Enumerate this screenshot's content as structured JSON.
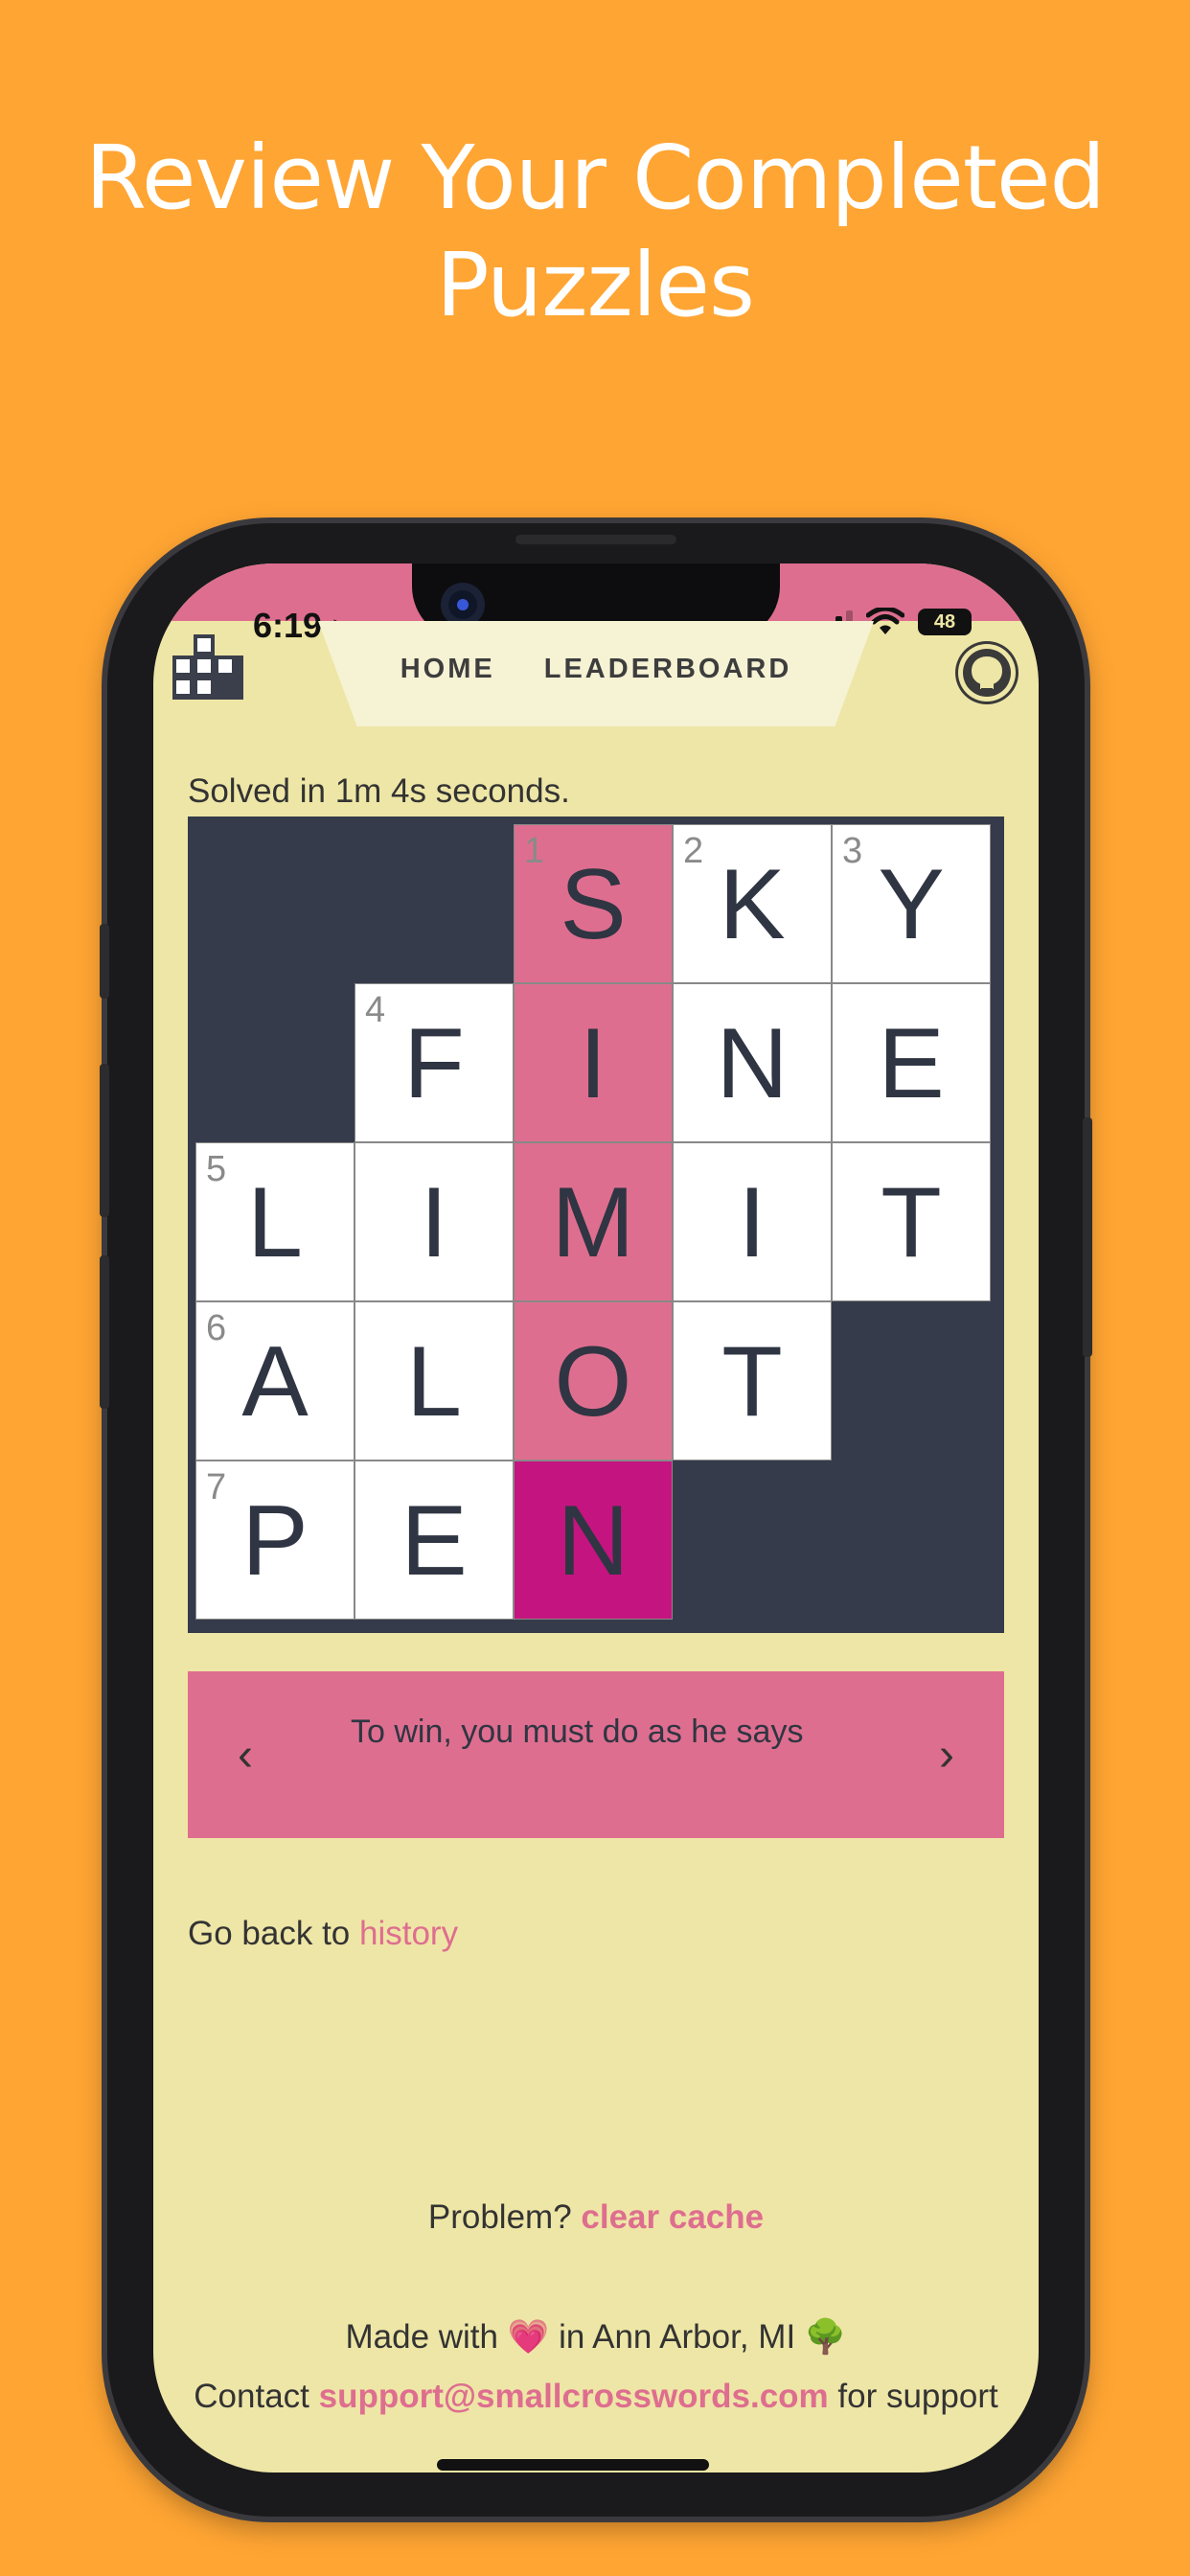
{
  "headline": {
    "line1": "Review Your Completed",
    "line2": "Puzzles"
  },
  "status_bar": {
    "time": "6:19",
    "battery": "48"
  },
  "nav": {
    "home": "HOME",
    "leaderboard": "LEADERBOARD"
  },
  "solved_text": "Solved in 1m 4s seconds.",
  "grid": {
    "cells": [
      {
        "row": 0,
        "col": 0,
        "state": "black"
      },
      {
        "row": 0,
        "col": 1,
        "state": "black"
      },
      {
        "row": 0,
        "col": 2,
        "state": "hl",
        "num": "1",
        "letter": "S"
      },
      {
        "row": 0,
        "col": 3,
        "state": "white",
        "num": "2",
        "letter": "K"
      },
      {
        "row": 0,
        "col": 4,
        "state": "white",
        "num": "3",
        "letter": "Y"
      },
      {
        "row": 1,
        "col": 0,
        "state": "black"
      },
      {
        "row": 1,
        "col": 1,
        "state": "white",
        "num": "4",
        "letter": "F"
      },
      {
        "row": 1,
        "col": 2,
        "state": "hl",
        "letter": "I"
      },
      {
        "row": 1,
        "col": 3,
        "state": "white",
        "letter": "N"
      },
      {
        "row": 1,
        "col": 4,
        "state": "white",
        "letter": "E"
      },
      {
        "row": 2,
        "col": 0,
        "state": "white",
        "num": "5",
        "letter": "L"
      },
      {
        "row": 2,
        "col": 1,
        "state": "white",
        "letter": "I"
      },
      {
        "row": 2,
        "col": 2,
        "state": "hl",
        "letter": "M"
      },
      {
        "row": 2,
        "col": 3,
        "state": "white",
        "letter": "I"
      },
      {
        "row": 2,
        "col": 4,
        "state": "white",
        "letter": "T"
      },
      {
        "row": 3,
        "col": 0,
        "state": "white",
        "num": "6",
        "letter": "A"
      },
      {
        "row": 3,
        "col": 1,
        "state": "white",
        "letter": "L"
      },
      {
        "row": 3,
        "col": 2,
        "state": "hl",
        "letter": "O"
      },
      {
        "row": 3,
        "col": 3,
        "state": "white",
        "letter": "T"
      },
      {
        "row": 3,
        "col": 4,
        "state": "black"
      },
      {
        "row": 4,
        "col": 0,
        "state": "white",
        "num": "7",
        "letter": "P"
      },
      {
        "row": 4,
        "col": 1,
        "state": "white",
        "letter": "E"
      },
      {
        "row": 4,
        "col": 2,
        "state": "cur",
        "letter": "N"
      },
      {
        "row": 4,
        "col": 3,
        "state": "black"
      },
      {
        "row": 4,
        "col": 4,
        "state": "black"
      }
    ]
  },
  "clue": {
    "prev_icon": "chevron-left-icon",
    "next_icon": "chevron-right-icon",
    "text": "To win, you must do as he says"
  },
  "back": {
    "prefix": "Go back to ",
    "link": "history"
  },
  "problem": {
    "prefix": "Problem? ",
    "link": "clear cache"
  },
  "footer": {
    "made_prefix": "Made with",
    "heart": "💗",
    "made_suffix": "in Ann Arbor, MI",
    "tree": "🌳",
    "contact_prefix": "Contact ",
    "email": "support@smallcrosswords.com",
    "contact_suffix": " for support"
  },
  "colors": {
    "background": "#FFA533",
    "app_bg": "#EEE6A6",
    "accent_pink": "#DE6E8F",
    "current_cell": "#C41480",
    "grid_black": "#353B4A"
  }
}
